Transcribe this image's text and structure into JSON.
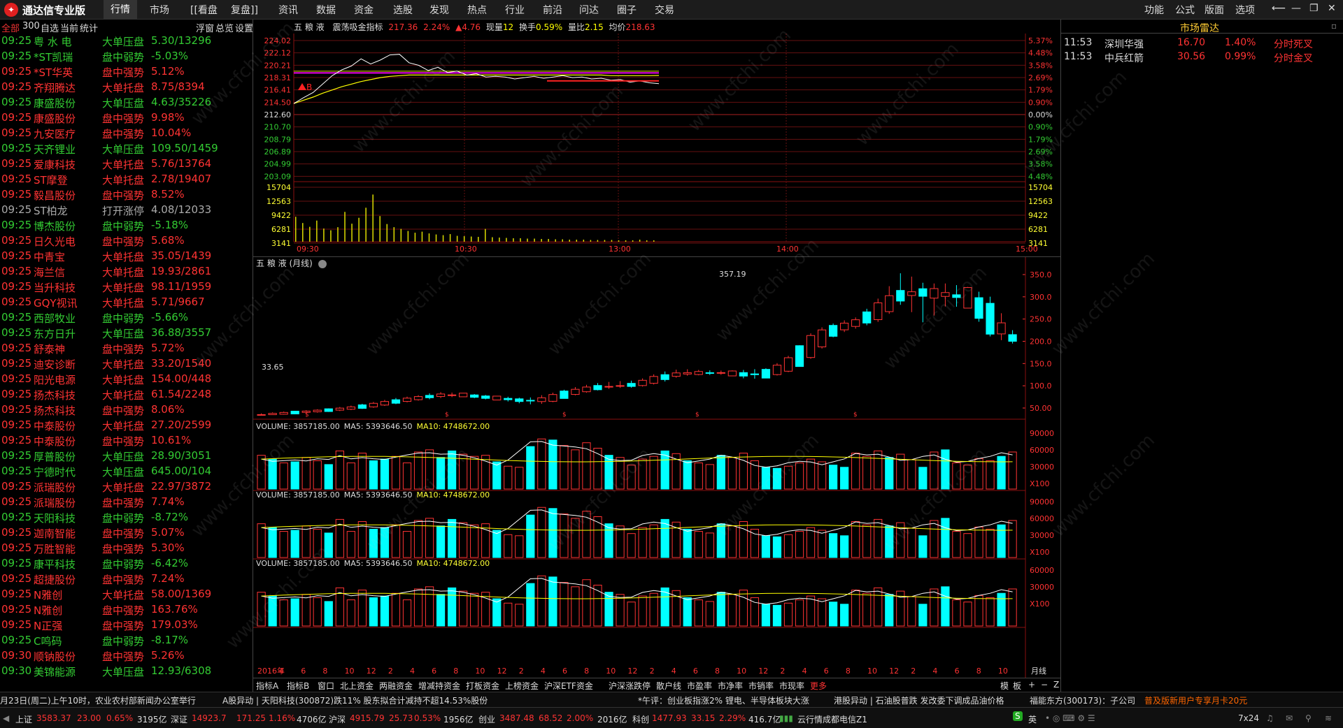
{
  "app": {
    "title": "通达信专业版"
  },
  "menu": [
    "行情",
    "市场",
    "[[看盘",
    "复盘]]",
    "资讯",
    "数据",
    "资金",
    "选股",
    "发现",
    "热点",
    "行业",
    "前沿",
    "问达",
    "圈子",
    "交易"
  ],
  "menu_right": [
    "功能",
    "公式",
    "版面",
    "选项"
  ],
  "left_head": {
    "all": "全部",
    "count": "300",
    "self": "自选",
    "now": "当前",
    "stats": "统计",
    "float": "浮窗",
    "total": "总览",
    "settings": "设置"
  },
  "left_rows": [
    {
      "t": "09:25",
      "name": "粤 水 电",
      "type": "大单压盘",
      "val": "5.30/13296",
      "c": "g"
    },
    {
      "t": "09:25",
      "name": "*ST凯瑞",
      "type": "盘中弱势",
      "val": "-5.03%",
      "c": "g"
    },
    {
      "t": "09:25",
      "name": "*ST华英",
      "type": "盘中强势",
      "val": "5.12%",
      "c": "r"
    },
    {
      "t": "09:25",
      "name": "齐翔腾达",
      "type": "大单托盘",
      "val": "8.75/8394",
      "c": "r"
    },
    {
      "t": "09:25",
      "name": "康盛股份",
      "type": "大单压盘",
      "val": "4.63/35226",
      "c": "g"
    },
    {
      "t": "09:25",
      "name": "康盛股份",
      "type": "盘中强势",
      "val": "9.98%",
      "c": "r"
    },
    {
      "t": "09:25",
      "name": "九安医疗",
      "type": "盘中强势",
      "val": "10.04%",
      "c": "r"
    },
    {
      "t": "09:25",
      "name": "天齐锂业",
      "type": "大单压盘",
      "val": "109.50/1459",
      "c": "g"
    },
    {
      "t": "09:25",
      "name": "爱康科技",
      "type": "大单托盘",
      "val": "5.76/13764",
      "c": "r"
    },
    {
      "t": "09:25",
      "name": "ST摩登",
      "type": "大单托盘",
      "val": "2.78/19407",
      "c": "r"
    },
    {
      "t": "09:25",
      "name": "毅昌股份",
      "type": "盘中强势",
      "val": "8.52%",
      "c": "r"
    },
    {
      "t": "09:25",
      "name": "ST柏龙",
      "type": "打开涨停",
      "val": "4.08/12033",
      "c": "w"
    },
    {
      "t": "09:25",
      "name": "博杰股份",
      "type": "盘中弱势",
      "val": "-5.18%",
      "c": "g"
    },
    {
      "t": "09:25",
      "name": "日久光电",
      "type": "盘中强势",
      "val": "5.68%",
      "c": "r"
    },
    {
      "t": "09:25",
      "name": "中青宝",
      "type": "大单托盘",
      "val": "35.05/1439",
      "c": "r"
    },
    {
      "t": "09:25",
      "name": "海兰信",
      "type": "大单托盘",
      "val": "19.93/2861",
      "c": "r"
    },
    {
      "t": "09:25",
      "name": "当升科技",
      "type": "大单托盘",
      "val": "98.11/1959",
      "c": "r"
    },
    {
      "t": "09:25",
      "name": "GQY视讯",
      "type": "大单托盘",
      "val": "5.71/9667",
      "c": "r"
    },
    {
      "t": "09:25",
      "name": "西部牧业",
      "type": "盘中弱势",
      "val": "-5.66%",
      "c": "g"
    },
    {
      "t": "09:25",
      "name": "东方日升",
      "type": "大单压盘",
      "val": "36.88/3557",
      "c": "g"
    },
    {
      "t": "09:25",
      "name": "舒泰神",
      "type": "盘中强势",
      "val": "5.72%",
      "c": "r"
    },
    {
      "t": "09:25",
      "name": "迪安诊断",
      "type": "大单托盘",
      "val": "33.20/1540",
      "c": "r"
    },
    {
      "t": "09:25",
      "name": "阳光电源",
      "type": "大单托盘",
      "val": "154.00/448",
      "c": "r"
    },
    {
      "t": "09:25",
      "name": "扬杰科技",
      "type": "大单托盘",
      "val": "61.54/2248",
      "c": "r"
    },
    {
      "t": "09:25",
      "name": "扬杰科技",
      "type": "盘中强势",
      "val": "8.06%",
      "c": "r"
    },
    {
      "t": "09:25",
      "name": "中泰股份",
      "type": "大单托盘",
      "val": "27.20/2599",
      "c": "r"
    },
    {
      "t": "09:25",
      "name": "中泰股份",
      "type": "盘中强势",
      "val": "10.61%",
      "c": "r"
    },
    {
      "t": "09:25",
      "name": "厚普股份",
      "type": "大单压盘",
      "val": "28.90/3051",
      "c": "g"
    },
    {
      "t": "09:25",
      "name": "宁德时代",
      "type": "大单压盘",
      "val": "645.00/104",
      "c": "g"
    },
    {
      "t": "09:25",
      "name": "派瑞股份",
      "type": "大单托盘",
      "val": "22.97/3872",
      "c": "r"
    },
    {
      "t": "09:25",
      "name": "派瑞股份",
      "type": "盘中强势",
      "val": "7.74%",
      "c": "r"
    },
    {
      "t": "09:25",
      "name": "天阳科技",
      "type": "盘中弱势",
      "val": "-8.72%",
      "c": "g"
    },
    {
      "t": "09:25",
      "name": "迦南智能",
      "type": "盘中强势",
      "val": "5.07%",
      "c": "r"
    },
    {
      "t": "09:25",
      "name": "万胜智能",
      "type": "盘中强势",
      "val": "5.30%",
      "c": "r"
    },
    {
      "t": "09:25",
      "name": "康平科技",
      "type": "盘中弱势",
      "val": "-6.42%",
      "c": "g"
    },
    {
      "t": "09:25",
      "name": "超捷股份",
      "type": "盘中强势",
      "val": "7.24%",
      "c": "r"
    },
    {
      "t": "09:25",
      "name": "N雅创",
      "type": "大单托盘",
      "val": "58.00/1369",
      "c": "r"
    },
    {
      "t": "09:25",
      "name": "N雅创",
      "type": "盘中强势",
      "val": "163.76%",
      "c": "r"
    },
    {
      "t": "09:25",
      "name": "N正强",
      "type": "盘中强势",
      "val": "179.03%",
      "c": "r"
    },
    {
      "t": "09:25",
      "name": "C鸣码",
      "type": "盘中弱势",
      "val": "-8.17%",
      "c": "g"
    },
    {
      "t": "09:30",
      "name": "顺钠股份",
      "type": "盘中强势",
      "val": "5.26%",
      "c": "r"
    },
    {
      "t": "09:30",
      "name": "美锦能源",
      "type": "大单压盘",
      "val": "12.93/6308",
      "c": "g"
    }
  ],
  "intraday": {
    "header": {
      "name": "五 粮 液",
      "ind": "震荡吸金指标",
      "price": "217.36",
      "pct": "2.24%",
      "chg": "▲4.76",
      "now_label": "现量",
      "now": "12",
      "turn_label": "换手",
      "turn": "0.59%",
      "qr_label": "量比",
      "qr": "2.15",
      "avg_label": "均价",
      "avg": "218.63"
    },
    "left_ticks": [
      "224.02",
      "222.12",
      "220.21",
      "218.31",
      "216.41",
      "214.50",
      "212.60",
      "210.70",
      "208.79",
      "206.89",
      "204.99",
      "203.09"
    ],
    "right_ticks": [
      "5.37%",
      "4.48%",
      "3.58%",
      "2.69%",
      "1.79%",
      "0.90%",
      "0.00%",
      "0.90%",
      "1.79%",
      "2.69%",
      "3.58%",
      "4.48%"
    ],
    "vol_ticks": [
      "15704",
      "12563",
      "9422",
      "6281",
      "3141"
    ],
    "time_ticks": [
      "09:30",
      "10:30",
      "13:00",
      "14:00",
      "15:00"
    ],
    "b_marker": "B",
    "price_series": [
      214.3,
      215.2,
      216.0,
      217.3,
      218.6,
      219.5,
      220.1,
      221.2,
      220.4,
      221.0,
      221.8,
      221.9,
      220.6,
      220.2,
      219.4,
      219.9,
      219.1,
      219.3,
      218.7,
      218.9,
      218.4,
      218.5,
      218.4,
      218.1,
      218.3,
      218.5,
      218.2,
      218.4,
      218.6,
      218.3,
      218.4,
      218.1,
      218.2,
      217.9,
      218.0,
      217.6,
      217.8,
      217.5,
      217.36
    ],
    "avg_series": [
      214.3,
      214.8,
      215.3,
      215.9,
      216.4,
      216.9,
      217.3,
      217.7,
      218.0,
      218.3,
      218.5,
      218.6,
      218.7,
      218.7,
      218.7,
      218.7,
      218.7,
      218.7,
      218.7,
      218.7,
      218.7,
      218.7,
      218.7,
      218.7,
      218.7,
      218.7,
      218.7,
      218.7,
      218.7,
      218.7,
      218.7,
      218.7,
      218.7,
      218.6,
      218.6,
      218.6,
      218.6,
      218.6,
      218.63
    ],
    "volume_series": [
      7200,
      5400,
      4300,
      6100,
      3800,
      3300,
      4200,
      8600,
      5200,
      6900,
      9800,
      13600,
      7400,
      5100,
      4200,
      3700,
      3100,
      2600,
      2900,
      2400,
      2100,
      1900,
      2200,
      1700,
      1600,
      1500,
      1400,
      3700,
      1300,
      1200,
      1100,
      1000,
      1000,
      900,
      900,
      800,
      800,
      700,
      700,
      600,
      600,
      600,
      500,
      500,
      500,
      500,
      400,
      400,
      400,
      600,
      400,
      400
    ]
  },
  "kline": {
    "title": "五 粮 液 (月线)",
    "high_label": "357.19",
    "low_label": "33.65",
    "y_ticks": [
      "350.0",
      "300.0",
      "250.0",
      "200.0",
      "150.0",
      "100.0",
      "50.00"
    ]
  },
  "chart_data": {
    "type": "bar",
    "title": "五 粮 液 (月线)",
    "categories": [
      "2016年",
      "4",
      "6",
      "8",
      "10",
      "12",
      "2",
      "4",
      "6",
      "8",
      "10",
      "12",
      "2",
      "4",
      "6",
      "8",
      "10",
      "12",
      "2",
      "4",
      "6",
      "8",
      "10",
      "12",
      "2",
      "4",
      "6",
      "8",
      "10",
      "12",
      "2",
      "4",
      "6",
      "8",
      "10"
    ],
    "series": [
      {
        "name": "open",
        "values": [
          34,
          36,
          40,
          43,
          47,
          52,
          60,
          68,
          75,
          82,
          78,
          72,
          70,
          62,
          78,
          90,
          100,
          98,
          108,
          125,
          130,
          128,
          130,
          120,
          135,
          168,
          220,
          235,
          250,
          290,
          320,
          300,
          310,
          285,
          215
        ]
      },
      {
        "name": "close",
        "values": [
          36,
          40,
          43,
          47,
          52,
          60,
          68,
          75,
          82,
          78,
          72,
          70,
          62,
          78,
          90,
          100,
          98,
          108,
          125,
          130,
          128,
          130,
          120,
          135,
          168,
          220,
          235,
          250,
          290,
          320,
          300,
          310,
          285,
          215,
          200
        ]
      },
      {
        "name": "high",
        "values": [
          38,
          42,
          45,
          49,
          55,
          63,
          72,
          78,
          86,
          84,
          80,
          76,
          72,
          82,
          95,
          105,
          110,
          112,
          130,
          138,
          135,
          134,
          136,
          140,
          172,
          225,
          242,
          255,
          300,
          357.19,
          330,
          330,
          322,
          300,
          225
        ]
      },
      {
        "name": "low",
        "values": [
          33.65,
          35,
          38,
          41,
          45,
          50,
          58,
          66,
          72,
          76,
          70,
          66,
          58,
          60,
          76,
          88,
          95,
          96,
          105,
          122,
          124,
          125,
          115,
          118,
          133,
          165,
          215,
          230,
          245,
          285,
          240,
          280,
          275,
          210,
          195
        ]
      }
    ],
    "volume_panels": [
      {
        "label": "VOLUME: 3857185.00",
        "ma5": "MA5: 5393646.50",
        "ma10": "MA10: 4748672.00",
        "ticks": [
          "90000",
          "60000",
          "30000",
          "X100"
        ]
      },
      {
        "label": "VOLUME: 3857185.00",
        "ma5": "MA5: 5393646.50",
        "ma10": "MA10: 4748672.00",
        "ticks": [
          "90000",
          "60000",
          "30000",
          "X100"
        ]
      },
      {
        "label": "VOLUME: 3857185.00",
        "ma5": "MA5: 5393646.50",
        "ma10": "MA10: 4748672.00",
        "ticks": [
          "60000",
          "30000",
          "X100"
        ]
      }
    ],
    "volumes": [
      62,
      55,
      48,
      50,
      58,
      52,
      45,
      70,
      48,
      66,
      52,
      55,
      60,
      48,
      68,
      72,
      58,
      70,
      64,
      60,
      62,
      50,
      42,
      40,
      78,
      92,
      90,
      80,
      72,
      85,
      75,
      62,
      58,
      44,
      55,
      60,
      70,
      65,
      52,
      48,
      45,
      62,
      58,
      66,
      52,
      40,
      38,
      42,
      48,
      55,
      50,
      44,
      40,
      66,
      60,
      70,
      58,
      64,
      54,
      40,
      68,
      72,
      48,
      44,
      56,
      52,
      60,
      68,
      72,
      48,
      44,
      38
    ],
    "bottom_axis_label": "月线"
  },
  "tabs": [
    "指标A",
    "指标B",
    "窗口",
    "北上资金",
    "两融资金",
    "增减持资金",
    "打板资金",
    "上榜资金",
    "沪深ETF资金",
    "沪深涨跌停",
    "散户线",
    "市盈率",
    "市净率",
    "市销率",
    "市现率",
    "更多"
  ],
  "tab_right": [
    "模",
    "板",
    "+",
    "−",
    "Z"
  ],
  "radar": {
    "title": "市场雷达",
    "rows": [
      {
        "t": "11:53",
        "name": "深圳华强",
        "price": "16.70",
        "pct": "1.40%",
        "sig": "分时死叉"
      },
      {
        "t": "11:53",
        "name": "中兵红箭",
        "price": "30.56",
        "pct": "0.99%",
        "sig": "分时金叉"
      }
    ]
  },
  "news": [
    "月23日(周二)上午10时，农业农村部新闻办公室举行",
    "A股异动 | 天阳科技(300872)跌11% 股东拟合计减持不超14.53%股份",
    "*午评：创业板指涨2% 锂电、半导体板块大涨",
    "港股异动 | 石油股普跌 发改委下调成品油价格",
    "福能东方(300173)：子公司",
    "普及版新用户专享月卡20元"
  ],
  "status": {
    "sh_label": "上证",
    "sh": "3583.37",
    "sh_chg": "23.00",
    "sh_pct": "0.65%",
    "sh_amt": "3195亿",
    "sz_label": "深证",
    "sz": "14923.7",
    "sz_chg": "171.25",
    "sz_pct": "1.16%",
    "sz_amt": "4706亿",
    "hs_label": "沪深",
    "hs": "4915.79",
    "hs_chg": "25.73",
    "hs_pct": "0.53%",
    "hs_amt": "1956亿",
    "cy_label": "创业",
    "cy": "3487.48",
    "cy_chg": "68.52",
    "cy_pct": "2.00%",
    "cy_amt": "2016亿",
    "kc_label": "科创",
    "kc": "1477.93",
    "kc_chg": "33.15",
    "kc_pct": "2.29%",
    "kc_amt": "416.7亿",
    "server": "云行情成都电信Z1",
    "ime": "英",
    "clock": "7x24"
  }
}
